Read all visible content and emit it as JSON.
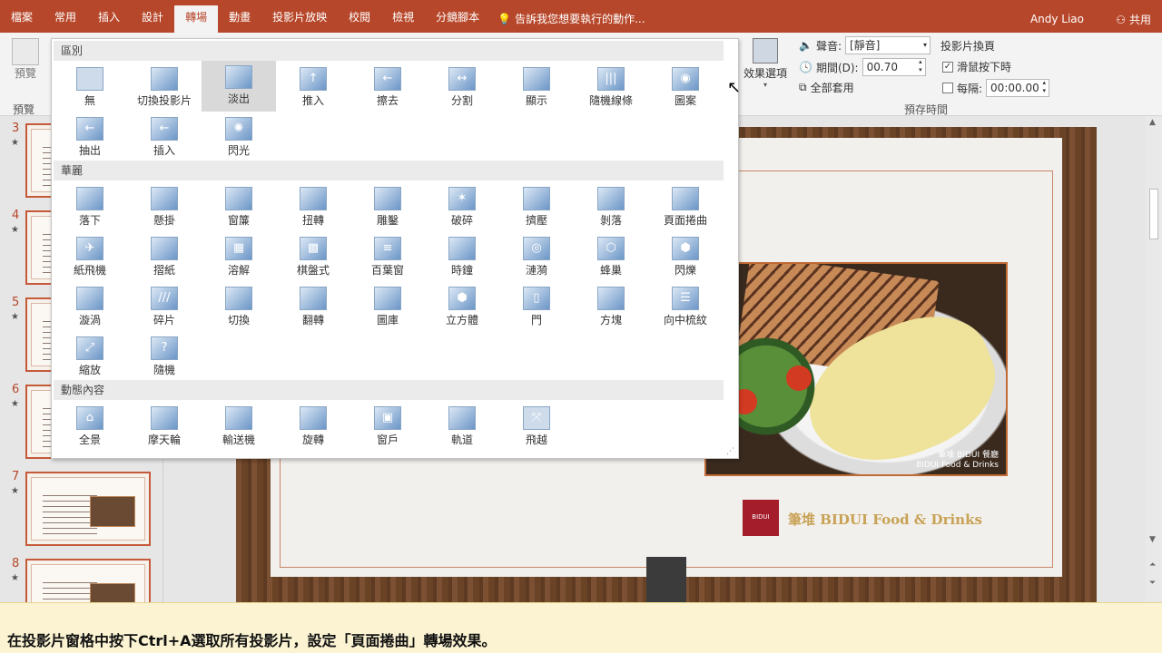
{
  "ribbon_tabs": [
    "檔案",
    "常用",
    "插入",
    "設計",
    "轉場",
    "動畫",
    "投影片放映",
    "校閱",
    "檢視",
    "分鏡腳本"
  ],
  "active_tab": "轉場",
  "tell_me": "告訴我您想要執行的動作...",
  "user_name": "Andy Liao",
  "share_label": "共用",
  "preview": {
    "button_label": "預覽",
    "group_label": "預覽"
  },
  "effect_options_label": "效果選項",
  "timing": {
    "sound_label": "聲音:",
    "sound_value": "[靜音]",
    "duration_label": "期間(D):",
    "duration_value": "00.70",
    "apply_all_label": "全部套用",
    "advance_label": "投影片換頁",
    "on_click_label": "滑鼠按下時",
    "on_click_checked": true,
    "after_label": "每隔:",
    "after_value": "00:00.00",
    "after_checked": false,
    "group_label": "預存時間"
  },
  "gallery": {
    "sections": [
      {
        "title": "區別",
        "items": [
          "無",
          "切換投影片",
          "淡出",
          "推入",
          "擦去",
          "分割",
          "顯示",
          "隨機線條",
          "圖案",
          "抽出",
          "插入",
          "閃光"
        ]
      },
      {
        "title": "華麗",
        "items": [
          "落下",
          "懸掛",
          "窗簾",
          "扭轉",
          "雕鑿",
          "破碎",
          "擠壓",
          "剝落",
          "頁面捲曲",
          "紙飛機",
          "摺紙",
          "溶解",
          "棋盤式",
          "百葉窗",
          "時鐘",
          "漣漪",
          "蜂巢",
          "閃爍",
          "漩渦",
          "碎片",
          "切換",
          "翻轉",
          "圖庫",
          "立方體",
          "門",
          "方塊",
          "向中梳紋",
          "縮放",
          "隨機"
        ]
      },
      {
        "title": "動態內容",
        "items": [
          "全景",
          "摩天輪",
          "輸送機",
          "旋轉",
          "窗戶",
          "軌道",
          "飛越"
        ]
      }
    ],
    "selected": "淡出"
  },
  "thumbnails": [
    {
      "number": "3",
      "star": "★"
    },
    {
      "number": "4",
      "star": "★"
    },
    {
      "number": "5",
      "star": "★"
    },
    {
      "number": "6",
      "star": "★"
    },
    {
      "number": "7",
      "star": "★"
    },
    {
      "number": "8",
      "star": "★"
    }
  ],
  "slide": {
    "brand_logo_text": "BIDUI",
    "brand_name": "筆堆 BIDUI Food & Drinks",
    "photo_caption_line1": "筆堆 BIDUI 餐廳",
    "photo_caption_line2": "BIDUI Food & Drinks"
  },
  "caption": "在投影片窗格中按下Ctrl+A選取所有投影片，設定「頁面捲曲」轉場效果。"
}
